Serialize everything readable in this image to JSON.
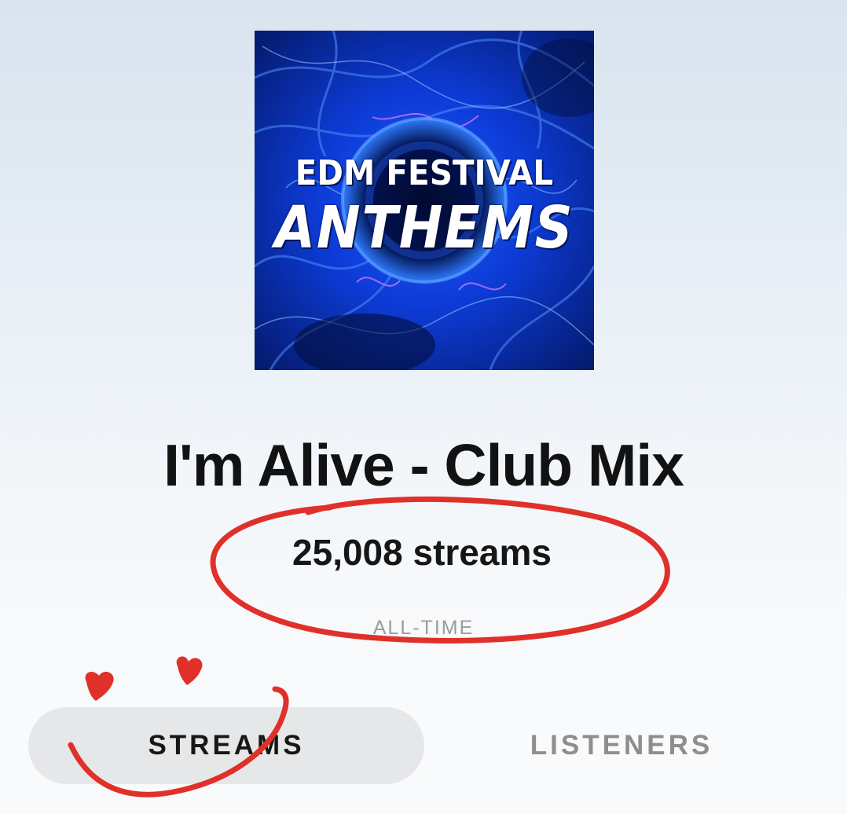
{
  "track": {
    "cover_art": {
      "line1": "EDM FESTIVAL",
      "line2": "ANTHEMS",
      "colors": {
        "background": "#0a2f9a",
        "accent_blue": "#2f6dff",
        "glow_pink": "#d27bff",
        "text": "#ffffff"
      }
    },
    "title": "I'm Alive - Club Mix",
    "streams": "25,008 streams",
    "period": "ALL-TIME"
  },
  "tabs": [
    {
      "label": "STREAMS",
      "selected": true
    },
    {
      "label": "LISTENERS",
      "selected": false
    }
  ],
  "annotation": {
    "color": "#e0302a"
  },
  "colors": {
    "text_primary": "#121212",
    "text_muted": "#9c9c9c",
    "tab_selected_bg": "#e6e7e8",
    "tab_unselected_text": "#8e8e8e"
  }
}
